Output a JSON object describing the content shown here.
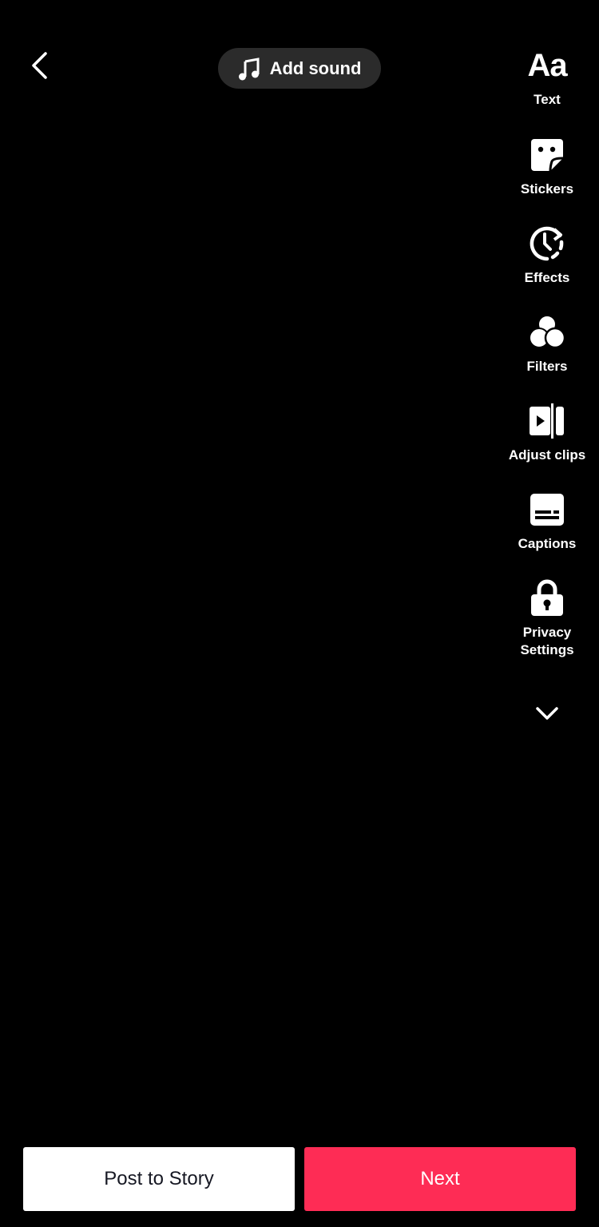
{
  "header": {
    "back_icon": "chevron-left-icon",
    "add_sound": {
      "icon": "music-note-icon",
      "label": "Add sound"
    }
  },
  "tools": [
    {
      "id": "text",
      "icon": "text-aa-icon",
      "glyph": "Aa",
      "label": "Text"
    },
    {
      "id": "stickers",
      "icon": "sticker-icon",
      "label": "Stickers"
    },
    {
      "id": "effects",
      "icon": "effects-clock-icon",
      "label": "Effects"
    },
    {
      "id": "filters",
      "icon": "filters-circles-icon",
      "label": "Filters"
    },
    {
      "id": "adjust-clips",
      "icon": "adjust-clips-icon",
      "label": "Adjust clips"
    },
    {
      "id": "captions",
      "icon": "captions-icon",
      "label": "Captions"
    },
    {
      "id": "privacy",
      "icon": "lock-icon",
      "label": "Privacy Settings"
    }
  ],
  "more_icon": "chevron-down-icon",
  "footer": {
    "post_to_story": "Post to Story",
    "next": "Next"
  },
  "colors": {
    "background": "#000000",
    "accent": "#fe2c55",
    "pill": "#2b2b2b",
    "story_text": "#161823"
  }
}
